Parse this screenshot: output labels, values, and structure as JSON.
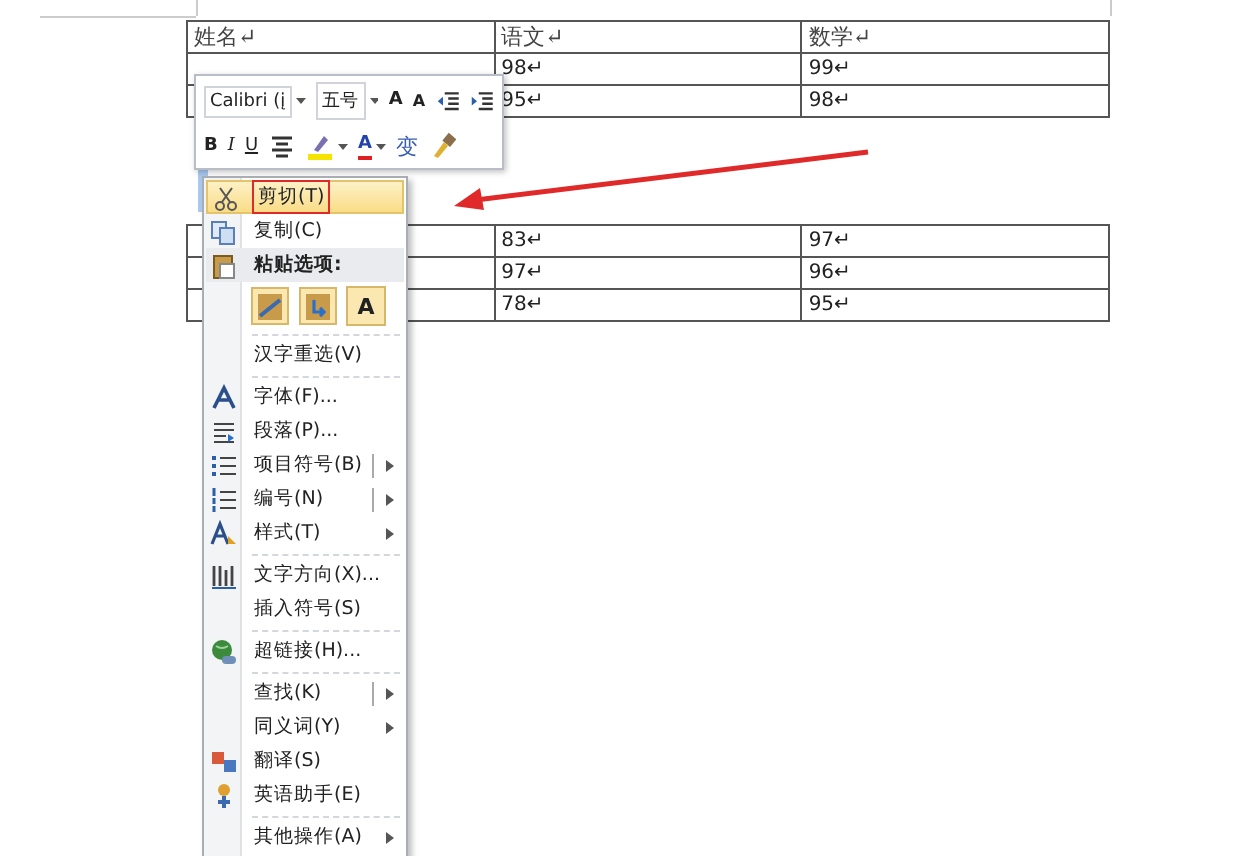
{
  "table_1": {
    "columns": [
      "姓名↵",
      "语文↵",
      "数学↵"
    ],
    "rows": [
      {
        "chinese": "98↵",
        "math": "99↵"
      },
      {
        "chinese": "95↵",
        "math": "98↵"
      }
    ]
  },
  "mini_toolbar": {
    "top_bar": [
      {
        "kind": "font",
        "value": "Calibri (į"
      },
      {
        "kind": "size",
        "value": "五号"
      },
      {
        "kind": "grow",
        "label": "A"
      },
      {
        "kind": "shrink",
        "label": "A"
      },
      {
        "kind": "outdent"
      },
      {
        "kind": "indent"
      }
    ],
    "bottom_bar": [
      {
        "kind": "bold",
        "label": "B"
      },
      {
        "kind": "italic",
        "label": "I"
      },
      {
        "kind": "underline",
        "label": "U"
      },
      {
        "kind": "center"
      },
      {
        "kind": "highlight"
      },
      {
        "kind": "font-color",
        "label": "A"
      },
      {
        "kind": "phonetic",
        "label": "变"
      },
      {
        "kind": "painter"
      }
    ]
  },
  "table_2": {
    "rows": [
      {
        "chinese": "83↵",
        "math": "97↵"
      },
      {
        "chinese": "97↵",
        "math": "96↵"
      },
      {
        "chinese": "78↵",
        "math": "95↵"
      }
    ]
  },
  "context_menu": {
    "items": [
      {
        "kind": "item",
        "label": "剪切(T)",
        "selected": true,
        "submenu": false,
        "split": false
      },
      {
        "kind": "item",
        "label": "复制(C)",
        "selected": false,
        "submenu": false,
        "split": false
      },
      {
        "kind": "header",
        "label": "粘贴选项:"
      },
      {
        "kind": "paste-row",
        "options": [
          {
            "kind": "keep"
          },
          {
            "kind": "merge"
          },
          {
            "kind": "text",
            "label": "A"
          }
        ]
      },
      {
        "kind": "separator"
      },
      {
        "kind": "item",
        "label": "汉字重选(V)",
        "selected": false,
        "submenu": false,
        "split": false
      },
      {
        "kind": "separator"
      },
      {
        "kind": "item",
        "label": "字体(F)...",
        "selected": false,
        "submenu": false,
        "split": false
      },
      {
        "kind": "item",
        "label": "段落(P)...",
        "selected": false,
        "submenu": false,
        "split": false
      },
      {
        "kind": "item",
        "label": "项目符号(B)",
        "selected": false,
        "submenu": true,
        "split": true
      },
      {
        "kind": "item",
        "label": "编号(N)",
        "selected": false,
        "submenu": true,
        "split": true
      },
      {
        "kind": "item",
        "label": "样式(T)",
        "selected": false,
        "submenu": true,
        "split": false
      },
      {
        "kind": "separator"
      },
      {
        "kind": "item",
        "label": "文字方向(X)...",
        "selected": false,
        "submenu": false,
        "split": false
      },
      {
        "kind": "item",
        "label": "插入符号(S)",
        "selected": false,
        "submenu": false,
        "split": false
      },
      {
        "kind": "separator"
      },
      {
        "kind": "item",
        "label": "超链接(H)...",
        "selected": false,
        "submenu": false,
        "split": false
      },
      {
        "kind": "separator"
      },
      {
        "kind": "item",
        "label": "查找(K)",
        "selected": false,
        "submenu": true,
        "split": true
      },
      {
        "kind": "item",
        "label": "同义词(Y)",
        "selected": false,
        "submenu": true,
        "split": false
      },
      {
        "kind": "item",
        "label": "翻译(S)",
        "selected": false,
        "submenu": false,
        "split": false
      },
      {
        "kind": "item",
        "label": "英语助手(E)",
        "selected": false,
        "submenu": false,
        "split": false
      },
      {
        "kind": "separator"
      },
      {
        "kind": "item",
        "label": "其他操作(A)",
        "selected": false,
        "submenu": true,
        "split": false
      }
    ]
  }
}
